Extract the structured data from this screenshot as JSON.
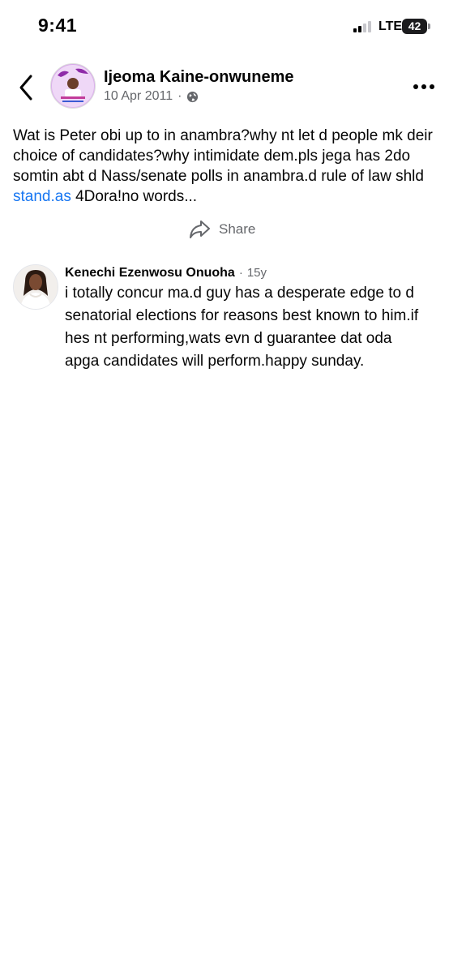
{
  "status_bar": {
    "time": "9:41",
    "network": "LTE",
    "battery": "42"
  },
  "post": {
    "author": "Ijeoma Kaine-onwuneme",
    "date": "10 Apr 2011",
    "privacy_icon": "globe-icon",
    "text_before_link": "Wat is Peter obi up to in anambra?why nt let d people mk deir choice of candidates?why intimidate dem.pls jega has 2do somtin abt d Nass/senate polls in anambra.d rule of law shld ",
    "link_text": "stand.as",
    "text_after_link": " 4Dora!no words...",
    "share_label": "Share"
  },
  "comment": {
    "author": "Kenechi Ezenwosu Onuoha",
    "time": "15y",
    "text": "i totally concur ma.d guy has a desperate edge to d senatorial elections for reasons best known to him.if hes nt performing,wats evn d guarantee dat oda apga candidates will perform.happy sunday."
  },
  "colors": {
    "link": "#1877f2",
    "secondary_text": "#65676b",
    "primary_text": "#050505"
  }
}
